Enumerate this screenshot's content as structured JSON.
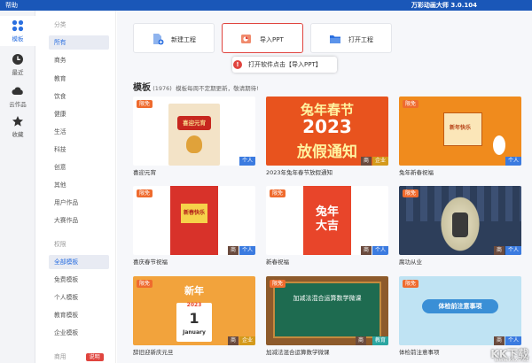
{
  "titlebar": {
    "help": "帮助",
    "title": "万彩动画大师 3.0.104",
    "bg": "#1a57b8"
  },
  "nav": [
    {
      "label": "模板",
      "icon": "template-icon",
      "active": true
    },
    {
      "label": "最近",
      "icon": "clock-icon",
      "active": false
    },
    {
      "label": "云作品",
      "icon": "cloud-icon",
      "active": false
    },
    {
      "label": "收藏",
      "icon": "star-icon",
      "active": false
    }
  ],
  "categories": {
    "head1": "分类",
    "items1": [
      "所有",
      "商务",
      "教育",
      "饮食",
      "健康",
      "生活",
      "科技",
      "创意",
      "其他",
      "用户作品",
      "大赛作品"
    ],
    "head2": "权限",
    "items2": [
      "全部模板",
      "免费模板",
      "个人模板",
      "教育模板",
      "企业模板"
    ],
    "head3": "商用",
    "explain": "说明"
  },
  "actions": {
    "new": "新建工程",
    "import": "导入PPT",
    "open": "打开工程"
  },
  "tooltip": {
    "num": "!",
    "text": "打开软件点击【导入PPT】"
  },
  "templates": {
    "heading": "模板",
    "count": "(1976)",
    "desc": "模板每周不定期更新，敬请期待!",
    "cards": [
      {
        "name": "喜迎元宵",
        "bg_text": "喜迎元宵",
        "free": "限免",
        "badges": [
          "个人"
        ]
      },
      {
        "name": "2023年兔年春节放假通知",
        "bg_text": "兔年春节",
        "bg_text2": "2023",
        "bg_text3": "放假通知",
        "free": "",
        "badges": [
          "商",
          "企业"
        ]
      },
      {
        "name": "兔年新春祝福",
        "bg_text": "新年快乐",
        "free": "限免",
        "badges": [
          "个人"
        ]
      },
      {
        "name": "喜庆春节祝福",
        "bg_text": "新春快乐",
        "free": "限免",
        "badges": [
          "商",
          "个人"
        ]
      },
      {
        "name": "新春祝福",
        "bg_text": "兔年",
        "bg_text2": "大吉",
        "free": "限免",
        "badges": [
          "商",
          "个人"
        ]
      },
      {
        "name": "腐功从业",
        "bg_text": "",
        "free": "限免",
        "badges": [
          "商",
          "个人"
        ]
      },
      {
        "name": "辞旧迎新庆元旦",
        "bg_text": "新年",
        "bg_text2": "2023",
        "bg_text3": "1",
        "bg_text4": "January",
        "free": "限免",
        "badges": [
          "商",
          "企业"
        ]
      },
      {
        "name": "加减法混合运算数学微课",
        "bg_text": "加减法混合运算数学微课",
        "free": "限免",
        "badges": [
          "商",
          "教育"
        ]
      },
      {
        "name": "体检前注意事项",
        "bg_text": "体检前注意事项",
        "free": "限免",
        "badges": [
          "商",
          "个人"
        ]
      }
    ]
  },
  "watermark": {
    "text": "KK下载",
    "url": "www.kkx.net"
  }
}
